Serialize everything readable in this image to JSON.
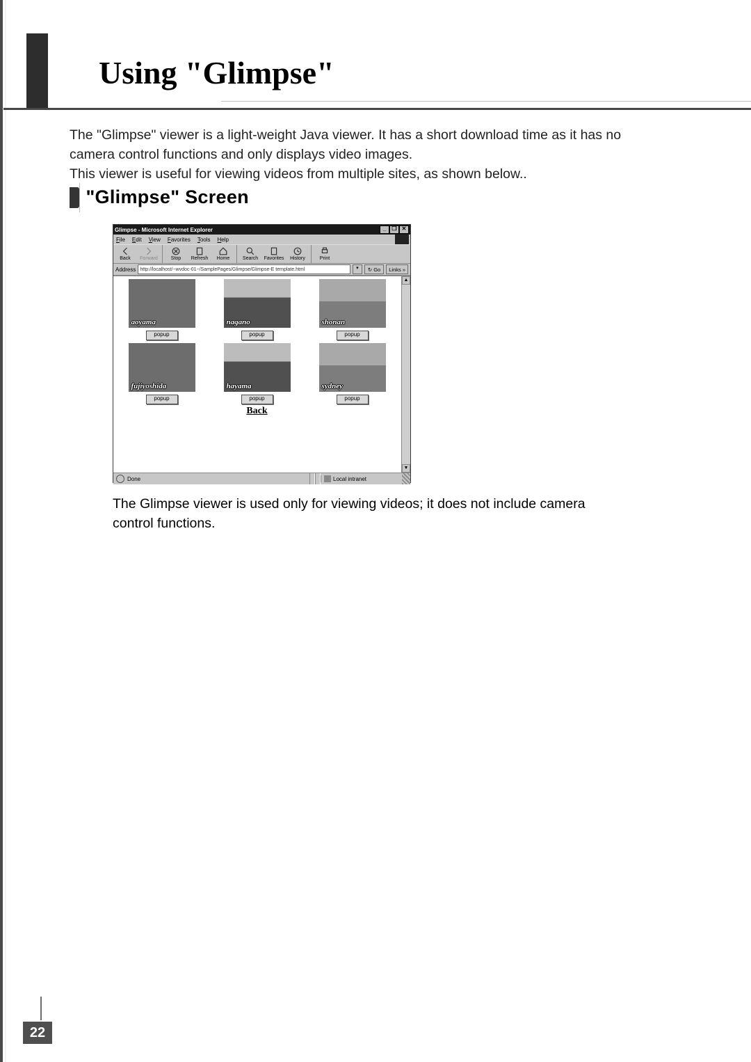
{
  "page": {
    "number": "22",
    "title": "Using \"Glimpse\""
  },
  "body": {
    "p1": "The \"Glimpse\" viewer is a light-weight Java viewer. It has a short download time as it has no camera control functions and only displays video images.",
    "p2": "This viewer is useful for viewing videos from multiple sites, as shown below..",
    "section_title": "\"Glimpse\" Screen",
    "caption": "The Glimpse viewer is used only for viewing videos; it does not include camera control functions."
  },
  "screenshot": {
    "window_title": "Glimpse - Microsoft Internet Explorer",
    "menu": [
      "File",
      "Edit",
      "View",
      "Favorites",
      "Tools",
      "Help"
    ],
    "toolbar": [
      {
        "label": "Back"
      },
      {
        "label": "Forward"
      },
      {
        "label": "Stop"
      },
      {
        "label": "Refresh"
      },
      {
        "label": "Home"
      },
      {
        "label": "Search"
      },
      {
        "label": "Favorites"
      },
      {
        "label": "History"
      },
      {
        "label": "Print"
      }
    ],
    "address_label": "Address",
    "address_value": "http://localhost/~wvdoc-01~/SamplePages/Glimpse/Glimpse-E template.html",
    "go": "Go",
    "links": "Links »",
    "cells": [
      {
        "name": "aoyama",
        "btn": "popup",
        "cls": "city"
      },
      {
        "name": "nagano",
        "btn": "popup",
        "cls": "bridge"
      },
      {
        "name": "shonan",
        "btn": "popup",
        "cls": "sea"
      },
      {
        "name": "fujiyoshida",
        "btn": "popup",
        "cls": "city"
      },
      {
        "name": "hayama",
        "btn": "popup",
        "cls": "bridge"
      },
      {
        "name": "sydney",
        "btn": "popup",
        "cls": "sea"
      }
    ],
    "back_link": "Back",
    "status_left": "Done",
    "status_right": "Local intranet"
  }
}
